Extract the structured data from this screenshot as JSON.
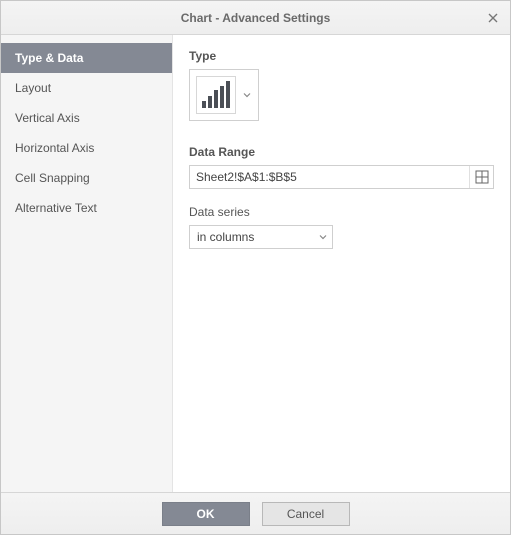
{
  "dialog": {
    "title": "Chart - Advanced Settings"
  },
  "sidebar": {
    "items": [
      {
        "label": "Type & Data"
      },
      {
        "label": "Layout"
      },
      {
        "label": "Vertical Axis"
      },
      {
        "label": "Horizontal Axis"
      },
      {
        "label": "Cell Snapping"
      },
      {
        "label": "Alternative Text"
      }
    ]
  },
  "content": {
    "type_label": "Type",
    "data_range_label": "Data Range",
    "data_range_value": "Sheet2!$A$1:$B$5",
    "data_series_label": "Data series",
    "data_series_value": "in columns"
  },
  "footer": {
    "ok": "OK",
    "cancel": "Cancel"
  }
}
